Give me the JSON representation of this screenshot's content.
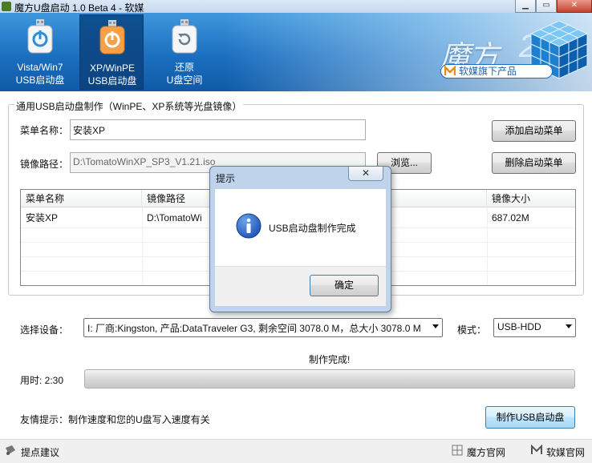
{
  "window": {
    "title": "魔方U盘启动 1.0 Beta 4 - 软媒",
    "controls": [
      "minimize-icon",
      "maximize-icon",
      "close-icon"
    ]
  },
  "nav": [
    {
      "line1": "Vista/Win7",
      "line2": "USB启动盘",
      "active": false,
      "icon": "usb-power-icon"
    },
    {
      "line1": "XP/WinPE",
      "line2": "USB启动盘",
      "active": true,
      "icon": "usb-power-icon"
    },
    {
      "line1": "还原",
      "line2": "U盘空间",
      "active": false,
      "icon": "usb-restore-icon"
    }
  ],
  "logo": {
    "name": "魔方",
    "number": "2",
    "tagline": "软媒旗下产品"
  },
  "group": {
    "title": "通用USB启动盘制作（WinPE、XP系统等光盘镜像）"
  },
  "form": {
    "menu_name_label": "菜单名称：",
    "menu_name_value": "安装XP",
    "image_path_label": "镜像路径：",
    "image_path_value": "D:\\TomatoWinXP_SP3_V1.21.iso",
    "browse_label": "浏览...",
    "add_menu_label": "添加启动菜单",
    "remove_menu_label": "删除启动菜单"
  },
  "table": {
    "columns": [
      "菜单名称",
      "镜像路径",
      "",
      "镜像大小"
    ],
    "rows": [
      {
        "name": "安装XP",
        "path": "D:\\TomatoWi",
        "size": "687.02M"
      }
    ]
  },
  "device": {
    "label": "选择设备：",
    "value": "I: 厂商:Kingston, 产品:DataTraveler G3,  剩余空间 3078.0 M，总大小 3078.0 M",
    "mode_label": "模式：",
    "mode_value": "USB-HDD"
  },
  "progress": {
    "status": "制作完成!",
    "time_label": "用时: 2:30",
    "percent": 100
  },
  "tip": {
    "text": "友情提示：制作速度和您的U盘写入速度有关"
  },
  "make_button_label": "制作USB启动盘",
  "statusbar": {
    "feedback": "提点建议",
    "site1": "魔方官网",
    "site2": "软媒官网"
  },
  "dialog": {
    "title": "提示",
    "message": "USB启动盘制作完成",
    "ok_label": "确定",
    "icon": "info-icon"
  },
  "colors": {
    "header_blue": "#1b6fc0",
    "active_tab": "#0f4f90",
    "button_blue": "#bee6fd"
  }
}
